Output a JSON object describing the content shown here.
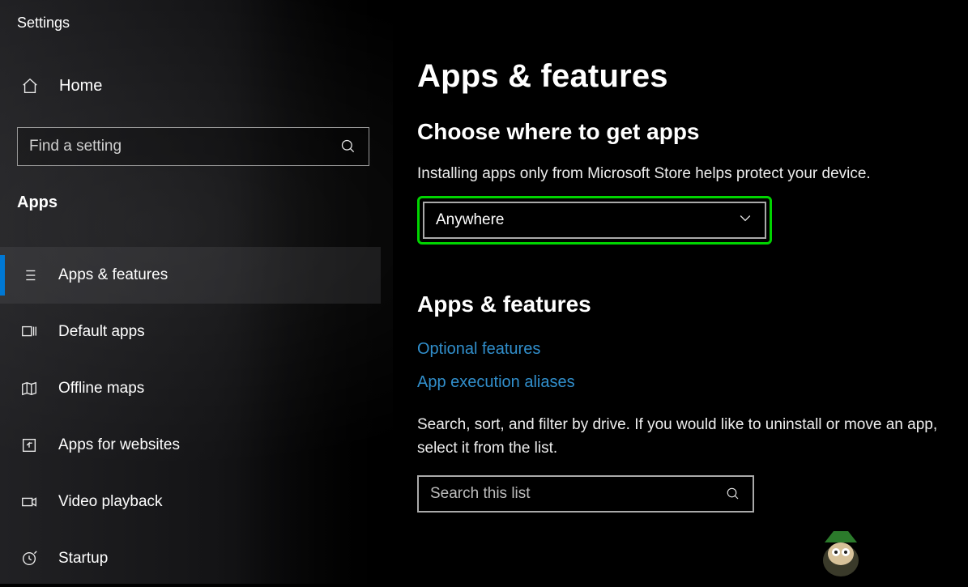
{
  "app_title": "Settings",
  "sidebar": {
    "home_label": "Home",
    "search_placeholder": "Find a setting",
    "section_title": "Apps",
    "items": [
      {
        "label": "Apps & features",
        "name": "sidebar-item-apps-features",
        "icon": "list-icon",
        "active": true
      },
      {
        "label": "Default apps",
        "name": "sidebar-item-default-apps",
        "icon": "defaults-icon",
        "active": false
      },
      {
        "label": "Offline maps",
        "name": "sidebar-item-offline-maps",
        "icon": "map-icon",
        "active": false
      },
      {
        "label": "Apps for websites",
        "name": "sidebar-item-apps-for-websites",
        "icon": "open-icon",
        "active": false
      },
      {
        "label": "Video playback",
        "name": "sidebar-item-video-playback",
        "icon": "video-icon",
        "active": false
      },
      {
        "label": "Startup",
        "name": "sidebar-item-startup",
        "icon": "startup-icon",
        "active": false
      }
    ]
  },
  "main": {
    "page_title": "Apps & features",
    "choose_heading": "Choose where to get apps",
    "choose_help": "Installing apps only from Microsoft Store helps protect your device.",
    "source_select_value": "Anywhere",
    "section2_heading": "Apps & features",
    "link_optional": "Optional features",
    "link_aliases": "App execution aliases",
    "desc": "Search, sort, and filter by drive. If you would like to uninstall or move an app, select it from the list.",
    "list_search_placeholder": "Search this list"
  }
}
